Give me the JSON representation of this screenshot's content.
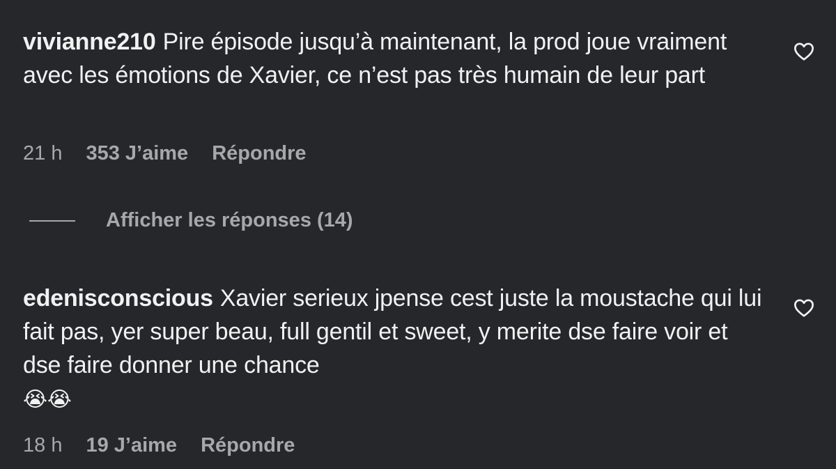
{
  "comments": [
    {
      "username": "vivianne210",
      "text": "Pire épisode jusqu’à maintenant, la prod joue vraiment avec les émotions de Xavier, ce n’est pas très humain de leur part",
      "emoji": "",
      "time": "21 h",
      "likes": "353 J’aime",
      "reply": "Répondre",
      "icon": "heart-outline-icon"
    },
    {
      "username": "edenisconscious",
      "text": "Xavier serieux jpense cest juste la moustache qui lui fait pas, yer super beau, full gentil et sweet, y merite dse faire voir et dse faire donner une chance",
      "emoji": "😭😭",
      "time": "18 h",
      "likes": "19 J’aime",
      "reply": "Répondre",
      "icon": "heart-outline-icon"
    }
  ],
  "replies_toggle": {
    "label": "Afficher les réponses (14)"
  },
  "colors": {
    "background": "#26272b",
    "text": "#f1f1f1",
    "muted": "#a8a8ab"
  }
}
